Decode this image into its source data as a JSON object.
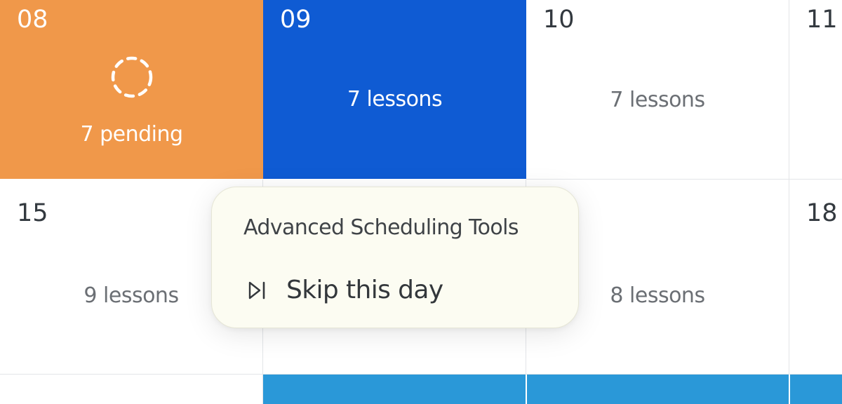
{
  "calendar": {
    "colors": {
      "pending": "#f0984a",
      "selected": "#0f5bd3",
      "highlight": "#2a98d8",
      "grid_line": "#e3e5e8"
    },
    "row1": {
      "day08": {
        "date": "08",
        "count": "7 pending",
        "icon": "pending-dashed-circle-icon"
      },
      "day09": {
        "date": "09",
        "count": "7 lessons"
      },
      "day10": {
        "date": "10",
        "count": "7 lessons"
      },
      "day11": {
        "date": "11"
      }
    },
    "row2": {
      "day15": {
        "date": "15",
        "count": "9 lessons"
      },
      "day17": {
        "count": "8 lessons"
      },
      "day18": {
        "date": "18"
      }
    }
  },
  "popover": {
    "title": "Advanced Scheduling Tools",
    "items": [
      {
        "label": "Skip this day",
        "icon": "skip-forward-icon"
      }
    ]
  }
}
